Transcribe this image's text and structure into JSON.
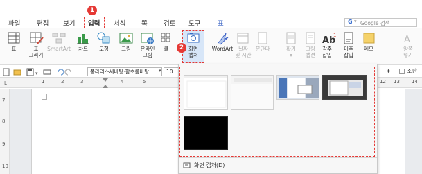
{
  "menu": {
    "items": [
      "파일",
      "편집",
      "보기",
      "입력",
      "서식",
      "쪽",
      "검토",
      "도구",
      "표"
    ],
    "active": "입력"
  },
  "search": {
    "placeholder": "Google 검색",
    "engine": "G"
  },
  "ribbon": {
    "table": "표",
    "table_draw": "표\n그리기",
    "smartart": "SmartArt",
    "chart": "차트",
    "shape": "도형",
    "picture": "그림",
    "online_picture_1": "온라인",
    "online_picture_2": "그림",
    "clipboard": "클",
    "screen_capture_1": "화면",
    "screen_capture_2": "캡처",
    "wordart": "WordArt",
    "datetime_1": "날짜",
    "datetime_2": "및 시간",
    "doc": "문단다",
    "bookmark_1": "책갈",
    "footnote_1": "각주",
    "footnote_2": "삽입",
    "endnote_1": "미주",
    "endnote_2": "삽입",
    "memo": "메모",
    "hidden_1": "양쪽",
    "hidden_2": "넣기",
    "dim1_1": "확기",
    "dim1_2": "",
    "dim2_1": "그림",
    "dim2_2": "캡션"
  },
  "toolbar": {
    "style": "풀라리스새바탕·함초롬바탕",
    "size": "10",
    "right_label": "조판"
  },
  "ruler": {
    "h": [
      "1",
      "2",
      "3",
      "4",
      "5",
      "12",
      "13",
      "14"
    ],
    "v": [
      "7",
      "8",
      "9",
      "10"
    ]
  },
  "dropdown": {
    "footer_label": "화면 캡처(D)"
  },
  "badges": {
    "one": "1",
    "two": "2"
  },
  "colors": {
    "accent": "#e53935",
    "highlight": "#d7e6f8",
    "brand": "#3a64c4"
  }
}
